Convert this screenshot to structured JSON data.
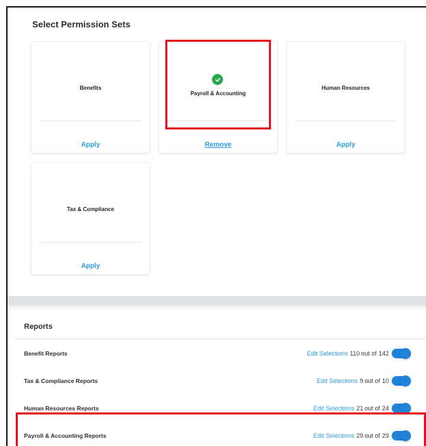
{
  "permissions": {
    "title": "Select Permission Sets",
    "cards": [
      {
        "label": "Benefits",
        "action": "Apply"
      },
      {
        "label": "Payroll & Accounting",
        "action": "Remove"
      },
      {
        "label": "Human Resources",
        "action": "Apply"
      },
      {
        "label": "Tax & Compliance",
        "action": "Apply"
      }
    ]
  },
  "reports": {
    "title": "Reports",
    "edit_label": "Edit Selections",
    "out_of_label": "out of",
    "rows": [
      {
        "label": "Benefit Reports",
        "selected": "110",
        "total": "142",
        "enabled": true
      },
      {
        "label": "Tax & Compliance Reports",
        "selected": "9",
        "total": "10",
        "enabled": true
      },
      {
        "label": "Human Resources Reports",
        "selected": "21",
        "total": "24",
        "enabled": true
      },
      {
        "label": "Payroll & Accounting Reports",
        "selected": "29",
        "total": "29",
        "enabled": true
      }
    ]
  },
  "colors": {
    "link": "#2f9be0",
    "check": "#27a84a",
    "toggle": "#1f82d8",
    "highlight": "#e8101a"
  },
  "icons": {
    "selected": "check-circle-icon"
  }
}
